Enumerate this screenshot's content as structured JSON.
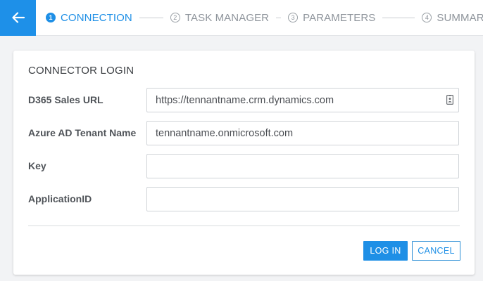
{
  "header": {
    "back_icon": "arrow-left-icon",
    "steps": [
      {
        "number": "1",
        "label": "CONNECTION",
        "active": true
      },
      {
        "number": "2",
        "label": "TASK MANAGER",
        "active": false
      },
      {
        "number": "3",
        "label": "PARAMETERS",
        "active": false
      },
      {
        "number": "4",
        "label": "SUMMARY",
        "active": false
      }
    ]
  },
  "form": {
    "title": "CONNECTOR LOGIN",
    "fields": [
      {
        "label": "D365 Sales URL",
        "value": "https://tennantname.crm.dynamics.com",
        "placeholder": "",
        "icon": "contact-card-icon"
      },
      {
        "label": "Azure AD Tenant Name",
        "value": "tennantname.onmicrosoft.com",
        "placeholder": ""
      },
      {
        "label": "Key",
        "value": "",
        "placeholder": ""
      },
      {
        "label": "ApplicationID",
        "value": "",
        "placeholder": ""
      }
    ],
    "login_label": "LOG IN",
    "cancel_label": "CANCEL"
  },
  "colors": {
    "accent": "#1e8fe6",
    "background": "#f2f3f5",
    "inactive_step": "#8f959c"
  }
}
